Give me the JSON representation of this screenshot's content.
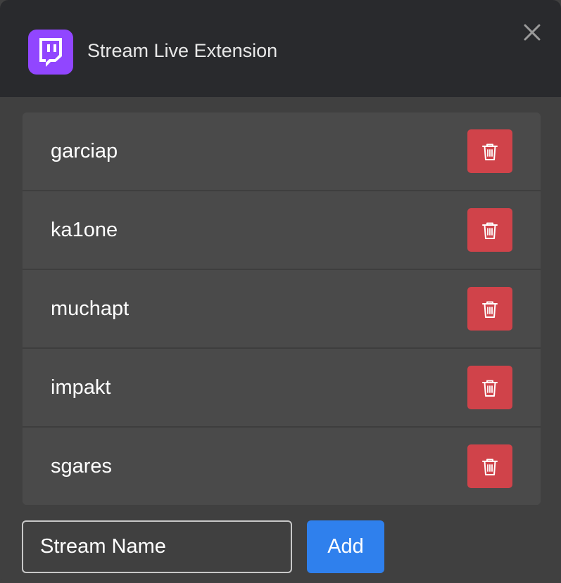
{
  "header": {
    "title": "Stream Live Extension",
    "logo_icon": "twitch-logo-icon",
    "close_icon": "close-icon"
  },
  "streams": [
    {
      "name": "garciap",
      "delete_icon": "trash-icon"
    },
    {
      "name": "ka1one",
      "delete_icon": "trash-icon"
    },
    {
      "name": "muchapt",
      "delete_icon": "trash-icon"
    },
    {
      "name": "impakt",
      "delete_icon": "trash-icon"
    },
    {
      "name": "sgares",
      "delete_icon": "trash-icon"
    }
  ],
  "form": {
    "placeholder": "Stream Name",
    "value": "",
    "add_label": "Add"
  },
  "colors": {
    "brand": "#9146ff",
    "header_bg": "#292a2d",
    "body_bg": "#404040",
    "row_bg": "#4a4a4a",
    "delete": "#d0434a",
    "primary": "#2f80ed"
  }
}
